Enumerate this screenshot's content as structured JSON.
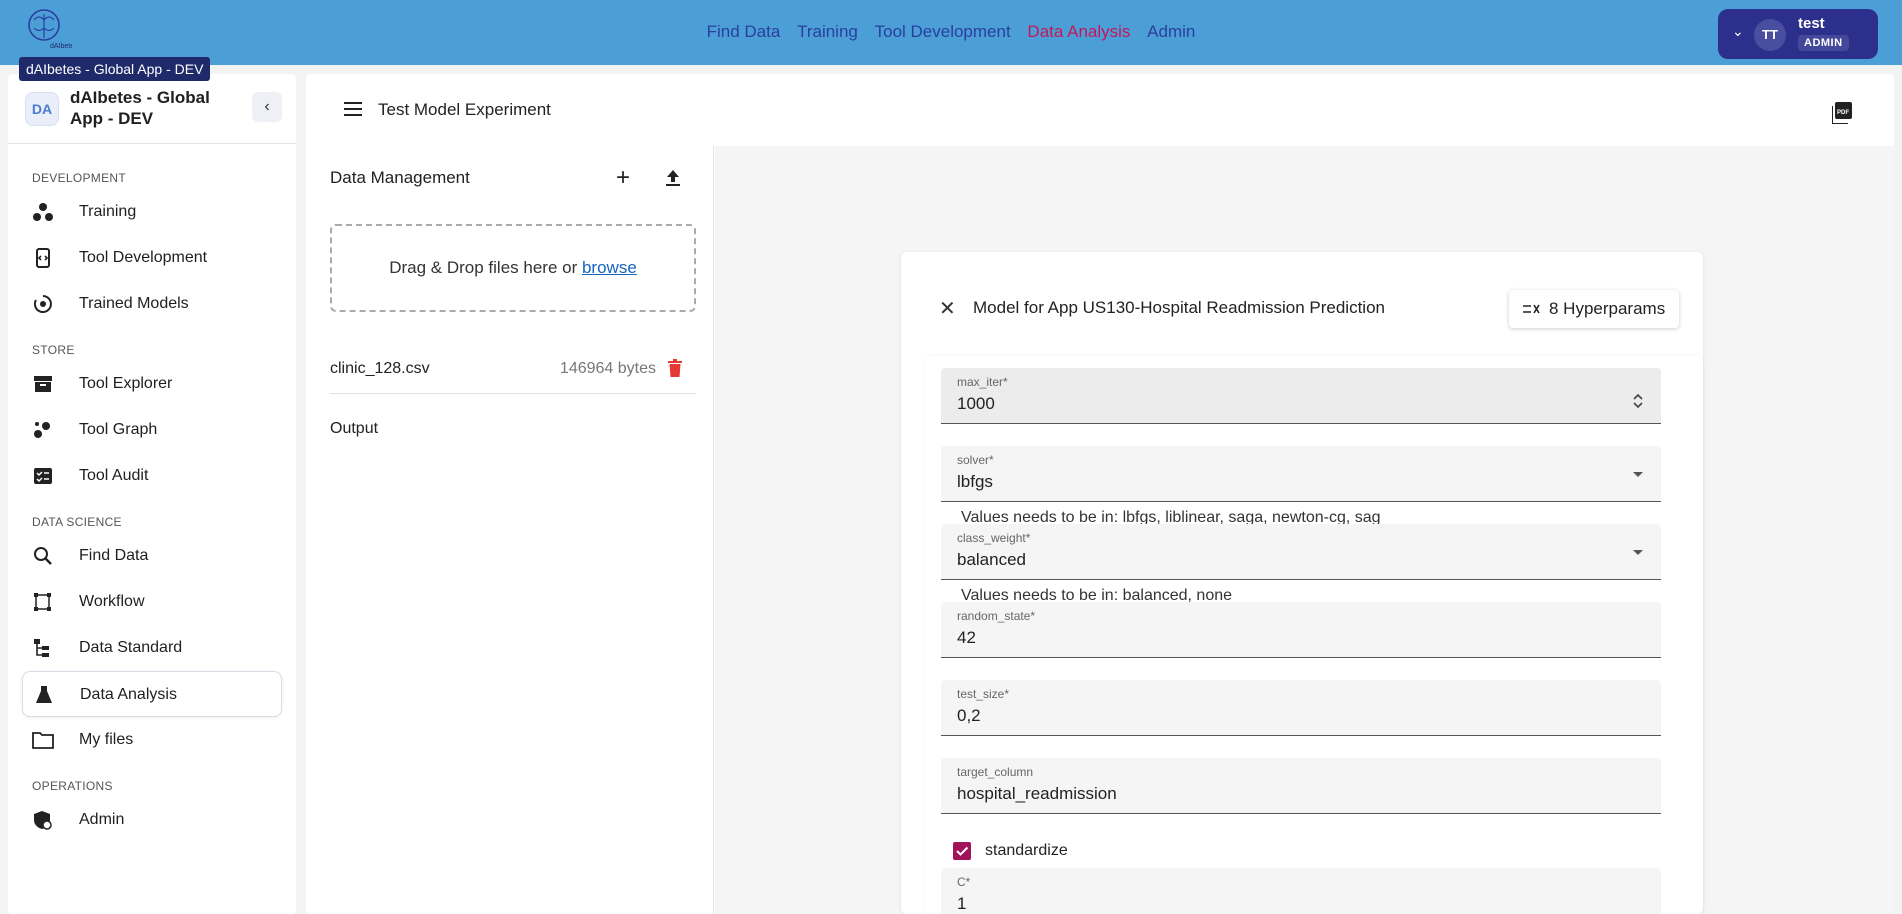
{
  "app": {
    "tooltip": "dAIbetes - Global App - DEV",
    "logo_text": "dAIbetes"
  },
  "topnav": {
    "items": [
      "Find Data",
      "Training",
      "Tool Development",
      "Data Analysis",
      "Admin"
    ],
    "active": "Data Analysis"
  },
  "user": {
    "initials": "TT",
    "name": "test",
    "role": "ADMIN"
  },
  "sidebar": {
    "badge": "DA",
    "title": "dAIbetes - Global App - DEV",
    "sections": [
      {
        "label": "DEVELOPMENT",
        "items": [
          {
            "label": "Training",
            "icon": "training-icon"
          },
          {
            "label": "Tool Development",
            "icon": "tool-development-icon"
          },
          {
            "label": "Trained Models",
            "icon": "trained-models-icon"
          }
        ]
      },
      {
        "label": "STORE",
        "items": [
          {
            "label": "Tool Explorer",
            "icon": "archive-icon"
          },
          {
            "label": "Tool Graph",
            "icon": "graph-icon"
          },
          {
            "label": "Tool Audit",
            "icon": "audit-icon"
          }
        ]
      },
      {
        "label": "DATA SCIENCE",
        "items": [
          {
            "label": "Find Data",
            "icon": "search-icon"
          },
          {
            "label": "Workflow",
            "icon": "workflow-icon"
          },
          {
            "label": "Data Standard",
            "icon": "data-standard-icon"
          },
          {
            "label": "Data Analysis",
            "icon": "flask-icon",
            "active": true
          },
          {
            "label": "My files",
            "icon": "folder-icon"
          }
        ]
      },
      {
        "label": "OPERATIONS",
        "items": [
          {
            "label": "Admin",
            "icon": "admin-shield-icon"
          }
        ]
      }
    ]
  },
  "main": {
    "experiment_title": "Test Model Experiment",
    "data_management": {
      "title": "Data Management",
      "dropzone_text": "Drag & Drop files here or ",
      "dropzone_link": "browse",
      "files": [
        {
          "name": "clinic_128.csv",
          "size": "146964 bytes"
        }
      ],
      "output_label": "Output"
    },
    "model": {
      "title": "Model for App US130-Hospital Readmission Prediction",
      "hyperparams_button": "8 Hyperparams",
      "fields": [
        {
          "label": "max_iter*",
          "value": "1000",
          "kind": "number"
        },
        {
          "label": "solver*",
          "value": "lbfgs",
          "kind": "select",
          "helper": "Values needs to be in: lbfgs, liblinear, saga, newton-cg, sag"
        },
        {
          "label": "class_weight*",
          "value": "balanced",
          "kind": "select",
          "helper": "Values needs to be in: balanced, none"
        },
        {
          "label": "random_state*",
          "value": "42",
          "kind": "text"
        },
        {
          "label": "test_size*",
          "value": "0,2",
          "kind": "text"
        },
        {
          "label": "target_column",
          "value": "hospital_readmission",
          "kind": "text"
        },
        {
          "label": "C*",
          "value": "1",
          "kind": "text"
        }
      ],
      "checkbox": {
        "label": "standardize",
        "checked": true
      }
    }
  },
  "colors": {
    "topbar": "#4c9fd6",
    "nav_link": "#2a3ea0",
    "nav_active": "#c2185b",
    "user_box": "#2c2f8c",
    "checkbox": "#a0125a",
    "delete": "#e53935",
    "link": "#1565c0"
  }
}
